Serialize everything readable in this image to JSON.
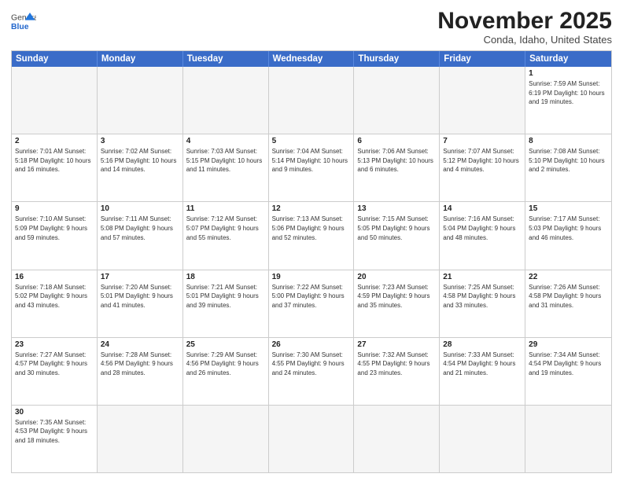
{
  "logo": {
    "text_general": "General",
    "text_blue": "Blue"
  },
  "title": "November 2025",
  "subtitle": "Conda, Idaho, United States",
  "header_days": [
    "Sunday",
    "Monday",
    "Tuesday",
    "Wednesday",
    "Thursday",
    "Friday",
    "Saturday"
  ],
  "weeks": [
    [
      {
        "day": "",
        "info": ""
      },
      {
        "day": "",
        "info": ""
      },
      {
        "day": "",
        "info": ""
      },
      {
        "day": "",
        "info": ""
      },
      {
        "day": "",
        "info": ""
      },
      {
        "day": "",
        "info": ""
      },
      {
        "day": "1",
        "info": "Sunrise: 7:59 AM\nSunset: 6:19 PM\nDaylight: 10 hours\nand 19 minutes."
      }
    ],
    [
      {
        "day": "2",
        "info": "Sunrise: 7:01 AM\nSunset: 5:18 PM\nDaylight: 10 hours\nand 16 minutes."
      },
      {
        "day": "3",
        "info": "Sunrise: 7:02 AM\nSunset: 5:16 PM\nDaylight: 10 hours\nand 14 minutes."
      },
      {
        "day": "4",
        "info": "Sunrise: 7:03 AM\nSunset: 5:15 PM\nDaylight: 10 hours\nand 11 minutes."
      },
      {
        "day": "5",
        "info": "Sunrise: 7:04 AM\nSunset: 5:14 PM\nDaylight: 10 hours\nand 9 minutes."
      },
      {
        "day": "6",
        "info": "Sunrise: 7:06 AM\nSunset: 5:13 PM\nDaylight: 10 hours\nand 6 minutes."
      },
      {
        "day": "7",
        "info": "Sunrise: 7:07 AM\nSunset: 5:12 PM\nDaylight: 10 hours\nand 4 minutes."
      },
      {
        "day": "8",
        "info": "Sunrise: 7:08 AM\nSunset: 5:10 PM\nDaylight: 10 hours\nand 2 minutes."
      }
    ],
    [
      {
        "day": "9",
        "info": "Sunrise: 7:10 AM\nSunset: 5:09 PM\nDaylight: 9 hours\nand 59 minutes."
      },
      {
        "day": "10",
        "info": "Sunrise: 7:11 AM\nSunset: 5:08 PM\nDaylight: 9 hours\nand 57 minutes."
      },
      {
        "day": "11",
        "info": "Sunrise: 7:12 AM\nSunset: 5:07 PM\nDaylight: 9 hours\nand 55 minutes."
      },
      {
        "day": "12",
        "info": "Sunrise: 7:13 AM\nSunset: 5:06 PM\nDaylight: 9 hours\nand 52 minutes."
      },
      {
        "day": "13",
        "info": "Sunrise: 7:15 AM\nSunset: 5:05 PM\nDaylight: 9 hours\nand 50 minutes."
      },
      {
        "day": "14",
        "info": "Sunrise: 7:16 AM\nSunset: 5:04 PM\nDaylight: 9 hours\nand 48 minutes."
      },
      {
        "day": "15",
        "info": "Sunrise: 7:17 AM\nSunset: 5:03 PM\nDaylight: 9 hours\nand 46 minutes."
      }
    ],
    [
      {
        "day": "16",
        "info": "Sunrise: 7:18 AM\nSunset: 5:02 PM\nDaylight: 9 hours\nand 43 minutes."
      },
      {
        "day": "17",
        "info": "Sunrise: 7:20 AM\nSunset: 5:01 PM\nDaylight: 9 hours\nand 41 minutes."
      },
      {
        "day": "18",
        "info": "Sunrise: 7:21 AM\nSunset: 5:01 PM\nDaylight: 9 hours\nand 39 minutes."
      },
      {
        "day": "19",
        "info": "Sunrise: 7:22 AM\nSunset: 5:00 PM\nDaylight: 9 hours\nand 37 minutes."
      },
      {
        "day": "20",
        "info": "Sunrise: 7:23 AM\nSunset: 4:59 PM\nDaylight: 9 hours\nand 35 minutes."
      },
      {
        "day": "21",
        "info": "Sunrise: 7:25 AM\nSunset: 4:58 PM\nDaylight: 9 hours\nand 33 minutes."
      },
      {
        "day": "22",
        "info": "Sunrise: 7:26 AM\nSunset: 4:58 PM\nDaylight: 9 hours\nand 31 minutes."
      }
    ],
    [
      {
        "day": "23",
        "info": "Sunrise: 7:27 AM\nSunset: 4:57 PM\nDaylight: 9 hours\nand 30 minutes."
      },
      {
        "day": "24",
        "info": "Sunrise: 7:28 AM\nSunset: 4:56 PM\nDaylight: 9 hours\nand 28 minutes."
      },
      {
        "day": "25",
        "info": "Sunrise: 7:29 AM\nSunset: 4:56 PM\nDaylight: 9 hours\nand 26 minutes."
      },
      {
        "day": "26",
        "info": "Sunrise: 7:30 AM\nSunset: 4:55 PM\nDaylight: 9 hours\nand 24 minutes."
      },
      {
        "day": "27",
        "info": "Sunrise: 7:32 AM\nSunset: 4:55 PM\nDaylight: 9 hours\nand 23 minutes."
      },
      {
        "day": "28",
        "info": "Sunrise: 7:33 AM\nSunset: 4:54 PM\nDaylight: 9 hours\nand 21 minutes."
      },
      {
        "day": "29",
        "info": "Sunrise: 7:34 AM\nSunset: 4:54 PM\nDaylight: 9 hours\nand 19 minutes."
      }
    ],
    [
      {
        "day": "30",
        "info": "Sunrise: 7:35 AM\nSunset: 4:53 PM\nDaylight: 9 hours\nand 18 minutes."
      },
      {
        "day": "",
        "info": ""
      },
      {
        "day": "",
        "info": ""
      },
      {
        "day": "",
        "info": ""
      },
      {
        "day": "",
        "info": ""
      },
      {
        "day": "",
        "info": ""
      },
      {
        "day": "",
        "info": ""
      }
    ]
  ]
}
